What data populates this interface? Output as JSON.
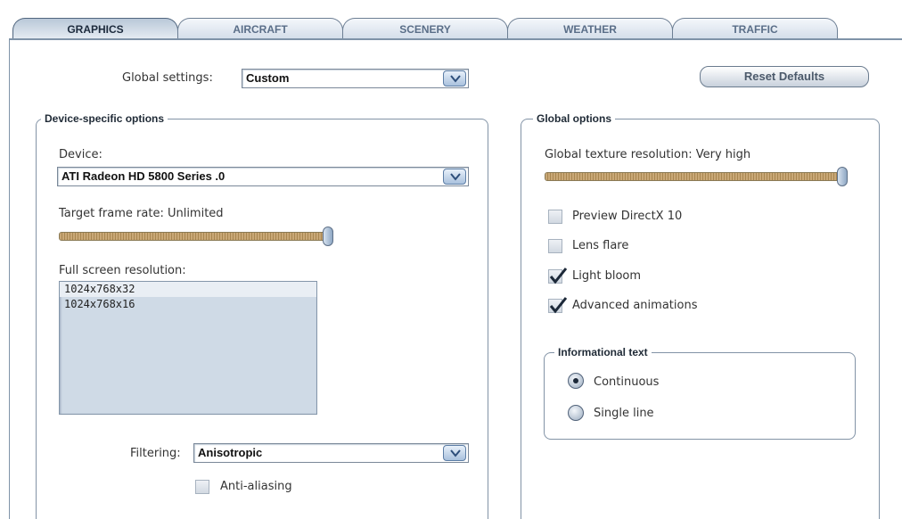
{
  "tabs": [
    {
      "label": "GRAPHICS",
      "active": true
    },
    {
      "label": "AIRCRAFT",
      "active": false
    },
    {
      "label": "SCENERY",
      "active": false
    },
    {
      "label": "WEATHER",
      "active": false
    },
    {
      "label": "TRAFFIC",
      "active": false
    }
  ],
  "global_settings": {
    "label": "Global settings:",
    "value": "Custom"
  },
  "reset_button": "Reset Defaults",
  "device_group": {
    "title": "Device-specific options",
    "device_label": "Device:",
    "device_value": "ATI Radeon HD 5800 Series  .0",
    "frame_rate_label": "Target frame rate: Unlimited",
    "frame_rate_level": 1.0,
    "resolution_label": "Full screen resolution:",
    "resolutions": [
      "1024x768x32",
      "1024x768x16"
    ],
    "selected_resolution": "1024x768x32",
    "filtering_label": "Filtering:",
    "filtering_value": "Anisotropic",
    "anti_aliasing": {
      "label": "Anti-aliasing",
      "checked": false
    }
  },
  "global_group": {
    "title": "Global options",
    "texture_label": "Global texture resolution: Very high",
    "texture_level": 1.0,
    "options": [
      {
        "label": "Preview DirectX 10",
        "checked": false
      },
      {
        "label": "Lens flare",
        "checked": false
      },
      {
        "label": "Light bloom",
        "checked": true
      },
      {
        "label": "Advanced animations",
        "checked": true
      }
    ],
    "info_text": {
      "title": "Informational text",
      "options": [
        {
          "label": "Continuous",
          "selected": true
        },
        {
          "label": "Single line",
          "selected": false
        }
      ]
    }
  },
  "colors": {
    "accent": "#7f93a8",
    "slider_fill": "#c9a877",
    "check_mark": "#1c2838"
  }
}
